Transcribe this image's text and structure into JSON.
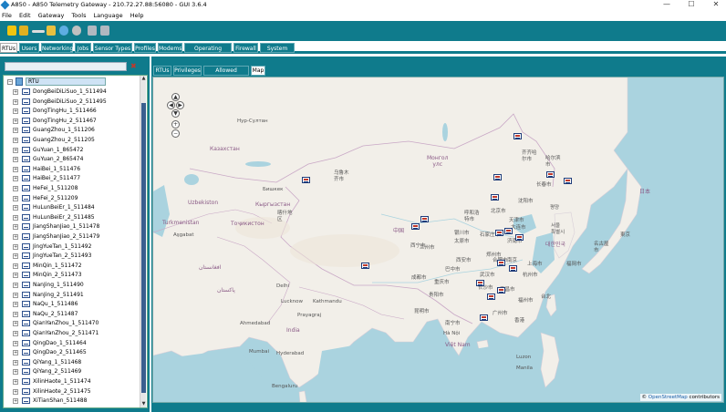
{
  "window": {
    "title": "A850 - A850 Telemetry Gateway - 210.72.27.88:56080 - GUI 3.6.4",
    "minimize": "—",
    "maximize": "☐",
    "close": "✕"
  },
  "menu": [
    "File",
    "Edit",
    "Gateway",
    "Tools",
    "Language",
    "Help"
  ],
  "toolbar": {
    "icons": [
      "lock-icon",
      "unlock-icon",
      "connect-icon",
      "key-icon",
      "refresh-icon",
      "stop-icon",
      "undo-icon",
      "redo-icon"
    ]
  },
  "main_tabs": [
    {
      "label": "RTUs",
      "active": true
    },
    {
      "label": "Users"
    },
    {
      "label": "Networking"
    },
    {
      "label": "Jobs"
    },
    {
      "label": "Sensor Types"
    },
    {
      "label": "Profiles"
    },
    {
      "label": "Modems"
    },
    {
      "label": "Operating System"
    },
    {
      "label": "Firewall"
    },
    {
      "label": "System Logs"
    }
  ],
  "search": {
    "value": "",
    "clear": "✖"
  },
  "tree": {
    "root": "RTU",
    "items": [
      "DongBeiDiLiSuo_1_511494",
      "DongBeiDiLiSuo_2_511495",
      "DongTingHu_1_511466",
      "DongTingHu_2_511467",
      "GuangZhou_1_511206",
      "GuangZhou_2_511205",
      "GuYuan_1_865472",
      "GuYuan_2_865474",
      "HaiBei_1_511476",
      "HaiBei_2_511477",
      "HeFei_1_511208",
      "HeFei_2_511209",
      "HuLunBeiEr_1_511484",
      "HuLunBeiEr_2_511485",
      "JiangShanJiao_1_511478",
      "JiangShanJiao_2_511479",
      "JingYueTan_1_511492",
      "JingYueTan_2_511493",
      "MinQin_1_511472",
      "MinQin_2_511473",
      "NanJing_1_511490",
      "NanJing_2_511491",
      "NaQu_1_511486",
      "NaQu_2_511487",
      "QianYanZhou_1_511470",
      "QianYanZhou_2_511471",
      "QingDao_1_511464",
      "QingDao_2_511465",
      "QiYang_1_511468",
      "QiYang_2_511469",
      "XilinHaote_1_511474",
      "XilinHaote_2_511475",
      "XiTianShan_511488"
    ]
  },
  "sub_tabs": [
    {
      "label": "RTUs"
    },
    {
      "label": "Privileges"
    },
    {
      "label": "Allowed modems"
    },
    {
      "label": "Map",
      "active": true
    }
  ],
  "map": {
    "labels": {
      "nursultan": "Нур-Султан",
      "kazakhstan": "Казахстан",
      "mongolia": "Монгол\nулс",
      "urumqi": "乌鲁木\n齐市",
      "bishkek": "Бишкек",
      "kyrgyzstan": "Кыргызстан",
      "uzbekistan": "Uzbekiston",
      "turkmenistan": "Turkmenistan",
      "ashgabat": "Aşgabat",
      "tajikistan": "Тоҷикистон",
      "kashgar": "喀什地\n区",
      "afghanistan": "افغانستان",
      "pakistan": "پاکستان",
      "delhi": "Delhi",
      "lucknow": "Lucknow",
      "kathmandu": "Kathmandu",
      "prayagraj": "Prayagraj",
      "ahmedabad": "Ahmedabad",
      "india": "India",
      "mumbai": "Mumbai",
      "hyderabad": "Hyderabad",
      "bengaluru": "Bengaluru",
      "china": "中国",
      "lanzhou": "兰州市",
      "chengdu": "成都市",
      "chongqing": "重庆市",
      "kunming": "昆明市",
      "guiyang": "贵阳市",
      "nanning": "南宁市",
      "hanoi": "Hà Nội",
      "vietnam": "Việt Nam",
      "huhehaote": "呼和浩\n特市",
      "beijing": "北京市",
      "tianjin": "天津市",
      "shijiazhuang": "石家庄市",
      "taiyuan": "太原市",
      "jinan": "济南市",
      "zhengzhou": "郑州市",
      "xian": "西安市",
      "wuhan": "武汉市",
      "changsha": "长沙市",
      "nanchang": "南昌市",
      "hangzhou": "杭州市",
      "fuzhou": "福州市",
      "taibei": "台北",
      "xianggang": "香港",
      "guangzhou": "广州市",
      "shenyang": "沈阳市",
      "dalian": "大连市",
      "changchun": "长春市",
      "haerbin": "哈尔滨\n市",
      "qiqihaer": "齐齐哈\n尔市",
      "pyongyang": "평양",
      "seoul": "서울\n특별시",
      "korea": "대한민국",
      "japan": "日本",
      "tokyo": "東京",
      "nagoya": "名古屋\n市",
      "fukuoka": "福岡市",
      "manila": "Manila",
      "luzon": "Luzon",
      "yinchuan": "银川市",
      "hefei": "合肥市",
      "nanjing": "南京",
      "shanghai": "上海市",
      "xining": "西宁市",
      "bajiaozhong": "巴中市"
    },
    "markers": [
      "rtu-marker"
    ],
    "zoom": {
      "up": "▲",
      "left": "◀",
      "right": "▶",
      "down": "▼",
      "in": "+",
      "out": "−"
    },
    "attribution": {
      "prefix": "©",
      "link": "OpenStreetMap",
      "suffix": "contributors"
    }
  }
}
